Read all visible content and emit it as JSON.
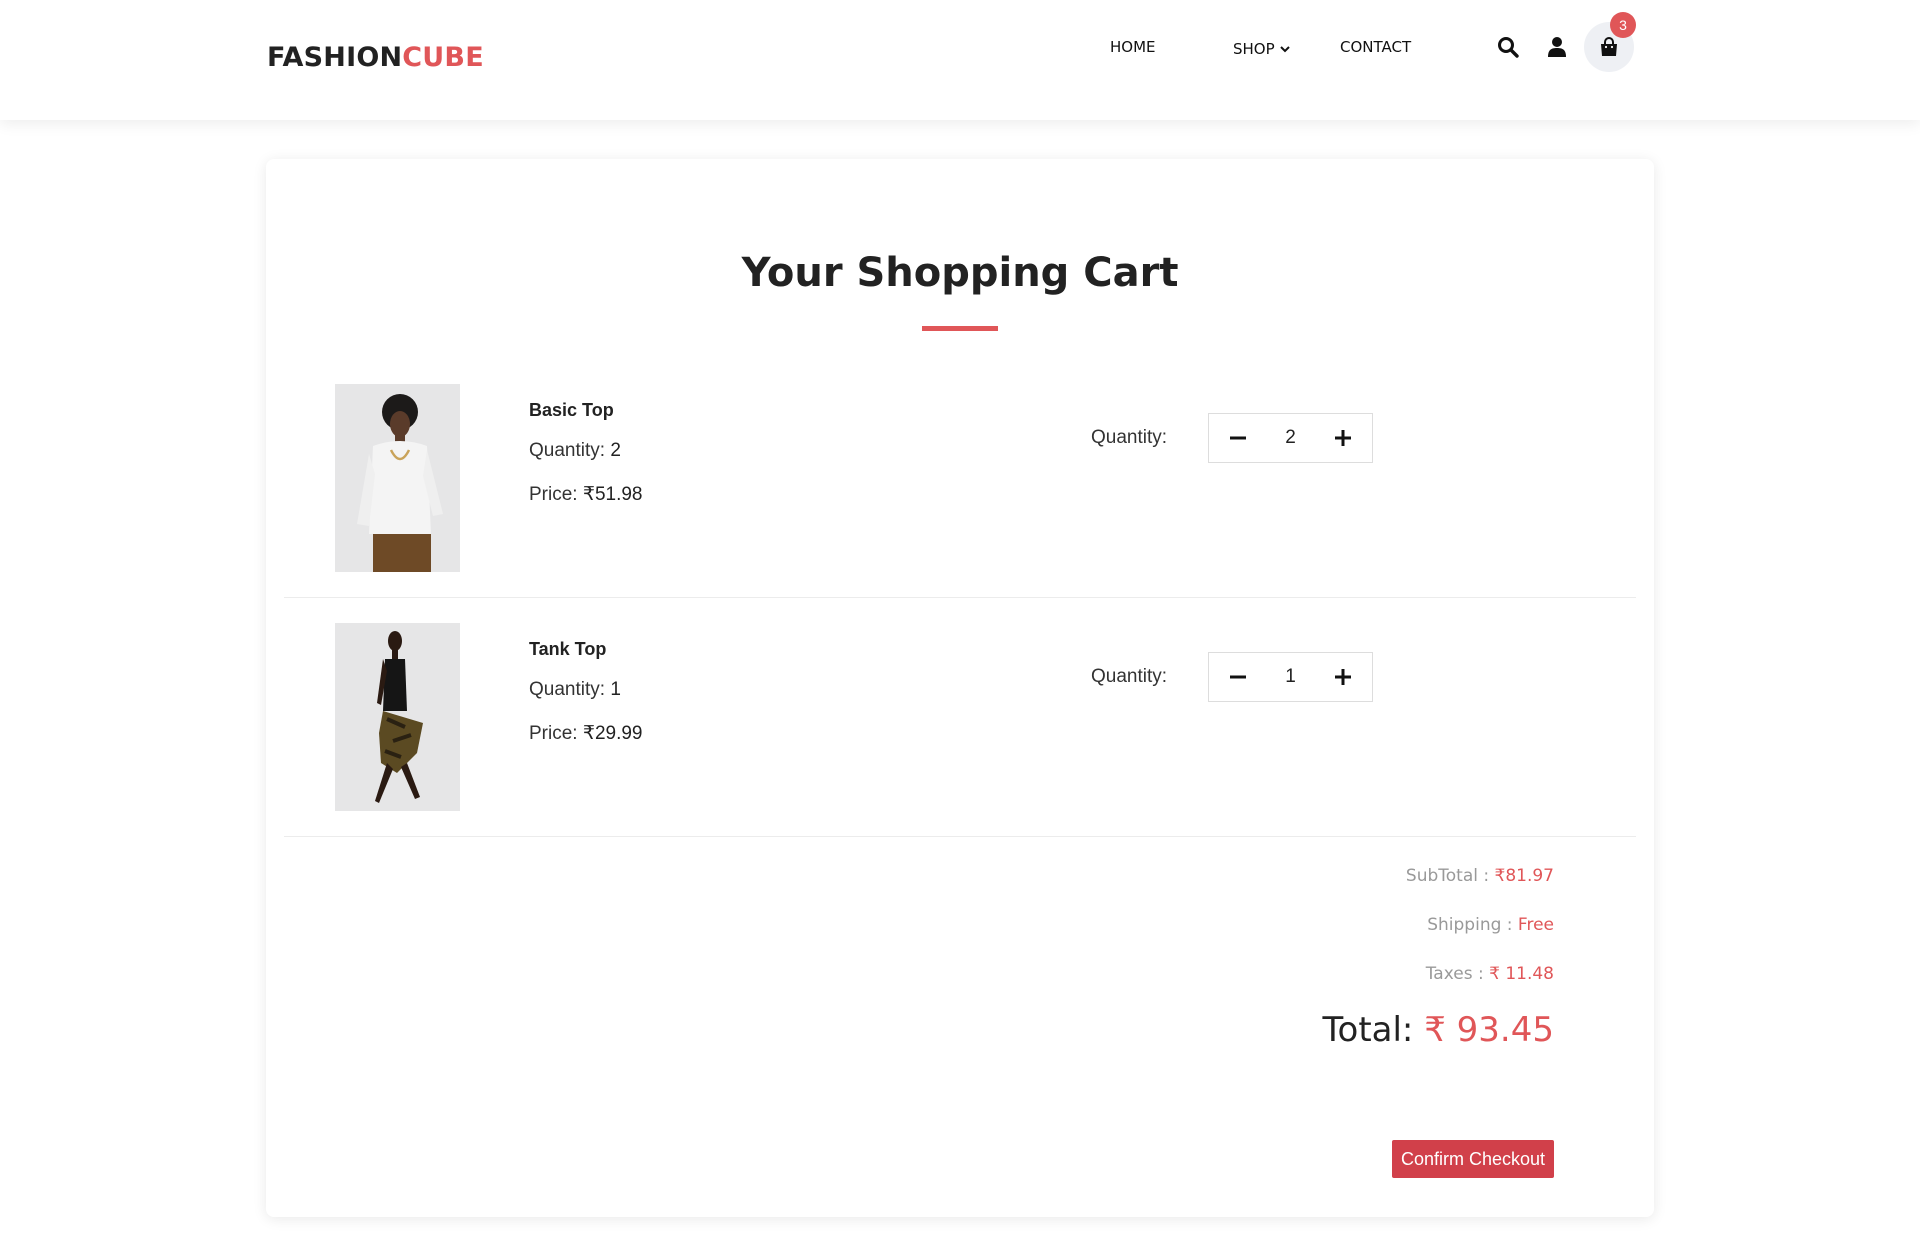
{
  "brand": {
    "part1": "FASHION",
    "part2": "CUBE",
    "accent_color": "#e05658"
  },
  "nav": {
    "home": "HOME",
    "shop": "SHOP",
    "contact": "CONTACT"
  },
  "header_icons": [
    "search-icon",
    "user-icon",
    "shopping-bag-icon"
  ],
  "cart_badge": "3",
  "page": {
    "title": "Your Shopping Cart"
  },
  "items": [
    {
      "name": "Basic Top",
      "quantity_label": "Quantity:",
      "quantity": "2",
      "price_label": "Price:",
      "price": "₹51.98",
      "stepper_label": "Quantity:",
      "image": "woman in white sweater and brown skirt"
    },
    {
      "name": "Tank Top",
      "quantity_label": "Quantity:",
      "quantity": "1",
      "price_label": "Price:",
      "price": "₹29.99",
      "stepper_label": "Quantity:",
      "image": "woman in black tank top and leopard print skirt"
    }
  ],
  "summary": {
    "subtotal_label": "SubTotal :",
    "subtotal": "₹81.97",
    "shipping_label": "Shipping :",
    "shipping": "Free",
    "taxes_label": "Taxes :",
    "taxes": "₹ 11.48",
    "total_label": "Total:",
    "total": "₹ 93.45"
  },
  "checkout_label": "Confirm Checkout",
  "checkout_color": "#d1404a"
}
